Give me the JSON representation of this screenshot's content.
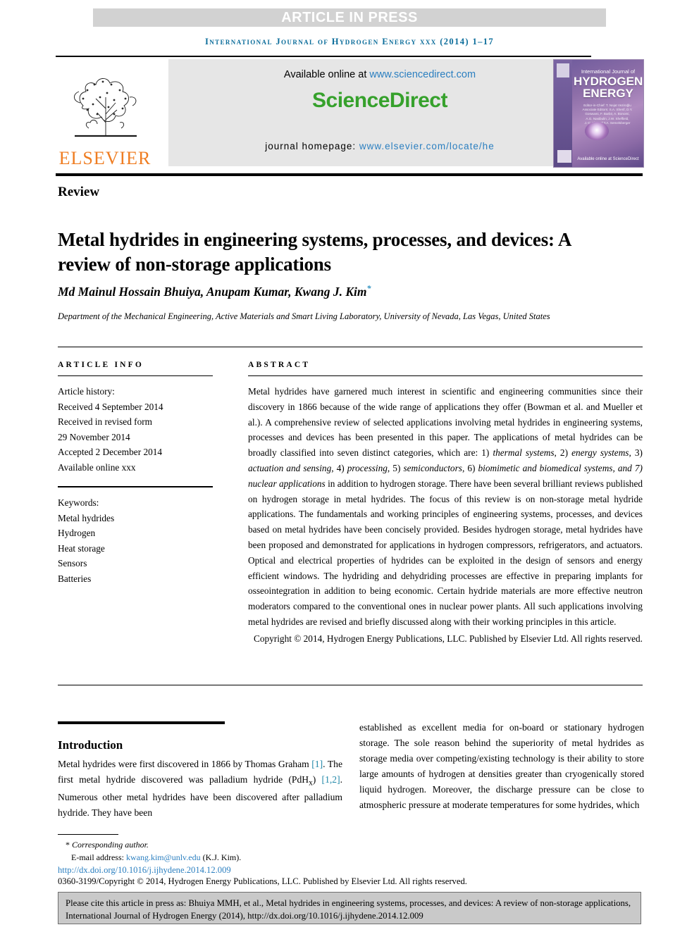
{
  "banner": {
    "article_in_press": "ARTICLE IN PRESS",
    "running_head": "International Journal of Hydrogen Energy xxx (2014) 1–17"
  },
  "masthead": {
    "elsevier_wordmark": "ELSEVIER",
    "available_prefix": "Available online at ",
    "sciencedirect_url": "www.sciencedirect.com",
    "sciencedirect_logo": "ScienceDirect",
    "homepage_prefix": "journal homepage: ",
    "homepage_url": "www.elsevier.com/locate/he",
    "cover": {
      "line1": "International Journal of",
      "line2": "HYDROGEN\nENERGY",
      "editors": "Editor-in-Chief: T. Nejat Veziroğlu\nAssociate Editors: S.A. Sherif, D.Y. Goswami, F. Barbir, A. Bonomi,\nA.G. Nasibulin, J.W. Sheffield,\nJ.-C. Lin and T.A. Semelsberger",
      "sciencedirect_mark": "Available online at ScienceDirect"
    }
  },
  "article": {
    "type": "Review",
    "title": "Metal hydrides in engineering systems, processes, and devices: A review of non-storage applications",
    "authors": "Md Mainul Hossain Bhuiya, Anupam Kumar, Kwang J. Kim",
    "corresponding_marker": "*",
    "affiliation": "Department of the Mechanical Engineering, Active Materials and Smart Living Laboratory, University of Nevada, Las Vegas, United States"
  },
  "article_info": {
    "heading": "ARTICLE INFO",
    "history_label": "Article history:",
    "history": [
      "Received 4 September 2014",
      "Received in revised form",
      "29 November 2014",
      "Accepted 2 December 2014",
      "Available online xxx"
    ],
    "keywords_label": "Keywords:",
    "keywords": [
      "Metal hydrides",
      "Hydrogen",
      "Heat storage",
      "Sensors",
      "Batteries"
    ]
  },
  "abstract": {
    "heading": "ABSTRACT",
    "part1": "Metal hydrides have garnered much interest in scientific and engineering communities since their discovery in 1866 because of the wide range of applications they offer (Bowman et al. and Mueller et al.). A comprehensive review of selected applications involving metal hydrides in engineering systems, processes and devices has been presented in this paper. The applications of metal hydrides can be broadly classified into seven distinct categories, which are: 1) ",
    "cat1": "thermal systems",
    "sep1": ", 2) ",
    "cat2": "energy systems",
    "sep2": ", 3) ",
    "cat3": "actuation and sensing",
    "sep3": ", 4) ",
    "cat4": "processing",
    "sep4": ", 5) ",
    "cat5": "semiconductors",
    "sep5": ", 6) ",
    "cat6": "biomimetic and biomedical systems, and 7) nuclear applications",
    "part2": " in addition to hydrogen storage. There have been several brilliant reviews published on hydrogen storage in metal hydrides. The focus of this review is on non-storage metal hydride applications. The fundamentals and working principles of engineering systems, processes, and devices based on metal hydrides have been concisely provided. Besides hydrogen storage, metal hydrides have been proposed and demonstrated for applications in hydrogen compressors, refrigerators, and actuators. Optical and electrical properties of hydrides can be exploited in the design of sensors and energy efficient windows. The hydriding and dehydriding processes are effective in preparing implants for osseointegration in addition to being economic. Certain hydride materials are more effective neutron moderators compared to the conventional ones in nuclear power plants. All such applications involving metal hydrides are revised and briefly discussed along with their working principles in this article.",
    "copyright": "Copyright © 2014, Hydrogen Energy Publications, LLC. Published by Elsevier Ltd. All rights reserved."
  },
  "introduction": {
    "heading": "Introduction",
    "left_p1_a": "Metal hydrides were first discovered in 1866 by Thomas Graham ",
    "left_ref1": "[1]",
    "left_p1_b": ". The first metal hydride discovered was palladium hydride (PdH",
    "left_sub": "x",
    "left_p1_c": ") ",
    "left_ref2": "[1,2]",
    "left_p1_d": ". Numerous other metal hydrides have been discovered after palladium hydride. They have been",
    "right_p1": "established as excellent media for on-board or stationary hydrogen storage. The sole reason behind the superiority of metal hydrides as storage media over competing/existing technology is their ability to store large amounts of hydrogen at densities greater than cryogenically stored liquid hydrogen. Moreover, the discharge pressure can be close to atmospheric pressure at moderate temperatures for some hydrides, which"
  },
  "footer": {
    "corresponding_marker": "*",
    "corresponding_label": "Corresponding author.",
    "email_label": "E-mail address: ",
    "email": "kwang.kim@unlv.edu",
    "email_suffix": " (K.J. Kim).",
    "doi": "http://dx.doi.org/10.1016/j.ijhydene.2014.12.009",
    "issn_copyright": "0360-3199/Copyright © 2014, Hydrogen Energy Publications, LLC. Published by Elsevier Ltd. All rights reserved.",
    "citation_notice": "Please cite this article in press as: Bhuiya MMH, et al., Metal hydrides in engineering systems, processes, and devices: A review of non-storage applications, International Journal of Hydrogen Energy (2014), http://dx.doi.org/10.1016/j.ijhydene.2014.12.009"
  },
  "colors": {
    "journal_head": "#0a6c9a",
    "link": "#2b7fc0",
    "sciencedirect_green": "#36a12c",
    "elsevier_orange": "#ef7d22",
    "citation_ref": "#1f87a8",
    "banner_gray": "#d2d2d2",
    "box_gray": "#c9c9c9"
  }
}
